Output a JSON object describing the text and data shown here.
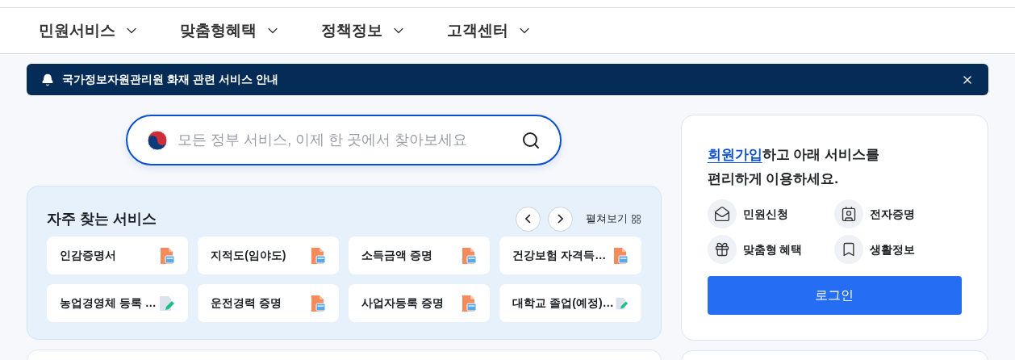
{
  "nav": [
    {
      "label": "민원서비스"
    },
    {
      "label": "맞춤형혜택"
    },
    {
      "label": "정책정보"
    },
    {
      "label": "고객센터"
    }
  ],
  "notice": {
    "text": "국가정보자원관리원 화재 관련 서비스 안내"
  },
  "search": {
    "placeholder": "모든 정부 서비스, 이제 한 곳에서 찾아보세요"
  },
  "frequent": {
    "title": "자주 찾는 서비스",
    "expand": "펼쳐보기",
    "items": [
      {
        "label": "인감증명서",
        "kind": "pdf"
      },
      {
        "label": "지적도(임야도)",
        "kind": "pdf"
      },
      {
        "label": "소득금액 증명",
        "kind": "pdf"
      },
      {
        "label": "건강보험 자격득…",
        "kind": "pdf"
      },
      {
        "label": "농업경영체 등록 …",
        "kind": "form"
      },
      {
        "label": "운전경력 증명",
        "kind": "pdf"
      },
      {
        "label": "사업자등록 증명",
        "kind": "pdf"
      },
      {
        "label": "대학교 졸업(예정)…",
        "kind": "form"
      }
    ]
  },
  "login_card": {
    "link": "회원가입",
    "line1": "하고 아래 서비스를",
    "line2": "편리하게 이용하세요.",
    "services": [
      {
        "label": "민원신청",
        "kind": "mail"
      },
      {
        "label": "전자증명",
        "kind": "id"
      },
      {
        "label": "맞춤형 혜택",
        "kind": "gift"
      },
      {
        "label": "생활정보",
        "kind": "book"
      }
    ],
    "button": "로그인"
  }
}
